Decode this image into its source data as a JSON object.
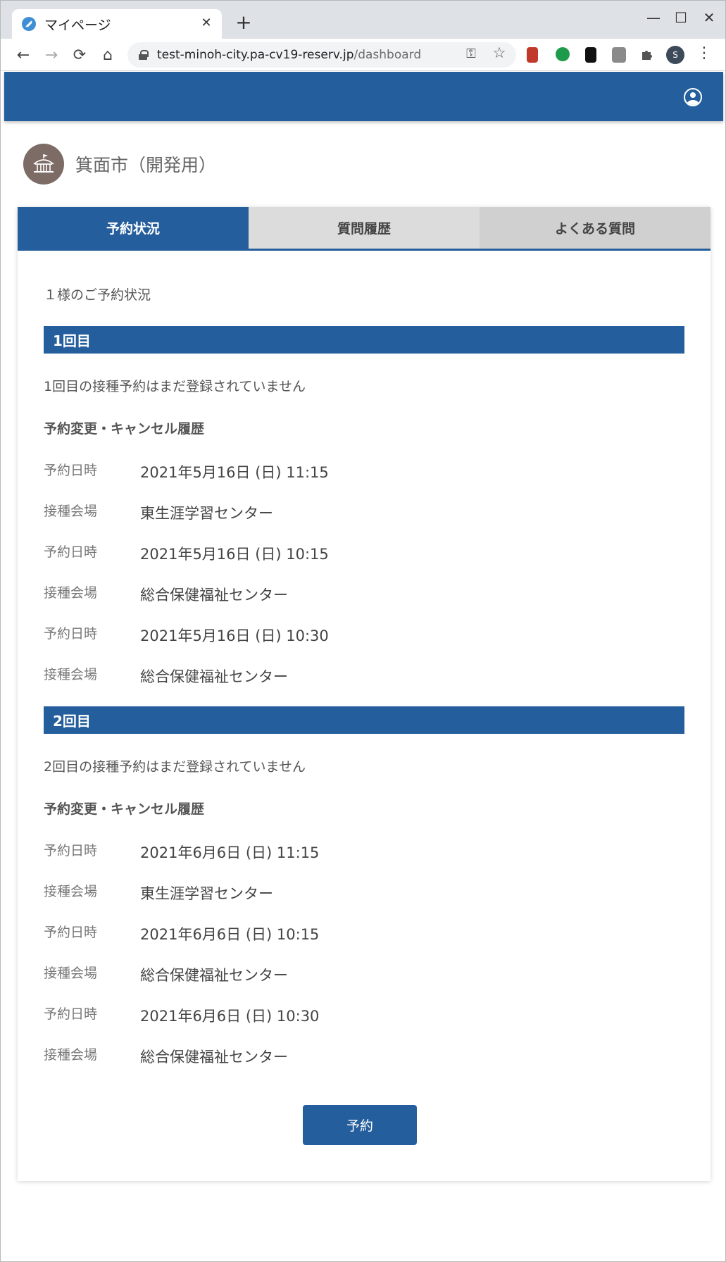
{
  "browser": {
    "tab_title": "マイページ",
    "close_glyph": "✕",
    "new_tab_glyph": "+",
    "minimize_glyph": "—",
    "maximize_glyph": "☐",
    "window_close_glyph": "✕",
    "back_glyph": "←",
    "forward_glyph": "→",
    "reload_glyph": "⟳",
    "home_glyph": "⌂",
    "url_host": "test-minoh-city.pa-cv19-reserv.jp",
    "url_path": "/dashboard",
    "key_glyph": "⚿",
    "star_glyph": "☆",
    "profile_initial": "S",
    "menu_glyph": "⋮",
    "extensions": [
      {
        "name": "extension-red-book-icon",
        "color": "#c0392b"
      },
      {
        "name": "extension-green-bubble-icon",
        "color": "#1e9b4a"
      },
      {
        "name": "extension-bookmark-icon",
        "color": "#111111"
      },
      {
        "name": "extension-line-icon",
        "color": "#8a8a8a"
      },
      {
        "name": "extensions-puzzle-icon",
        "color": "#555555"
      }
    ]
  },
  "app": {
    "header_color": "#255e9c",
    "org_name": "箕面市（開発用）",
    "tabs": [
      {
        "label": "予約状況",
        "active": true
      },
      {
        "label": "質問履歴",
        "active": false
      },
      {
        "label": "よくある質問",
        "active": false
      }
    ],
    "status_title": "１様のご予約状況",
    "sections": [
      {
        "title": "1回目",
        "not_registered": "1回目の接種予約はまだ登録されていません",
        "history_title": "予約変更・キャンセル履歴",
        "rows": [
          {
            "label": "予約日時",
            "value": "2021年5月16日 (日) 11:15"
          },
          {
            "label": "接種会場",
            "value": "東生涯学習センター"
          },
          {
            "label": "予約日時",
            "value": "2021年5月16日 (日) 10:15"
          },
          {
            "label": "接種会場",
            "value": "総合保健福祉センター"
          },
          {
            "label": "予約日時",
            "value": "2021年5月16日 (日) 10:30"
          },
          {
            "label": "接種会場",
            "value": "総合保健福祉センター"
          }
        ]
      },
      {
        "title": "2回目",
        "not_registered": "2回目の接種予約はまだ登録されていません",
        "history_title": "予約変更・キャンセル履歴",
        "rows": [
          {
            "label": "予約日時",
            "value": "2021年6月6日 (日) 11:15"
          },
          {
            "label": "接種会場",
            "value": "東生涯学習センター"
          },
          {
            "label": "予約日時",
            "value": "2021年6月6日 (日) 10:15"
          },
          {
            "label": "接種会場",
            "value": "総合保健福祉センター"
          },
          {
            "label": "予約日時",
            "value": "2021年6月6日 (日) 10:30"
          },
          {
            "label": "接種会場",
            "value": "総合保健福祉センター"
          }
        ]
      }
    ],
    "reserve_button": "予約"
  }
}
